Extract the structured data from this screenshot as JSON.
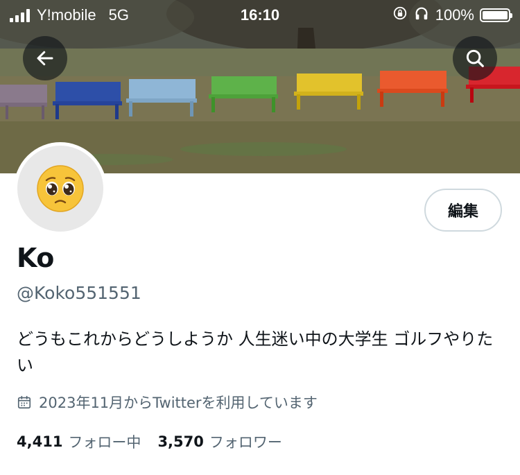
{
  "status_bar": {
    "carrier": "Y!mobile",
    "network": "5G",
    "time": "16:10",
    "battery": "100%"
  },
  "profile": {
    "display_name": "Ko",
    "handle": "@Koko551551",
    "bio": "どうもこれからどうしようか 人生迷い中の大学生 ゴルフやりたい",
    "joined": "2023年11月からTwitterを利用しています",
    "following_count": "4,411",
    "following_label": "フォロー中",
    "followers_count": "3,570",
    "followers_label": "フォロワー",
    "edit_button": "編集"
  },
  "icons": {
    "back": "arrow-left-icon",
    "search": "search-icon",
    "calendar": "calendar-icon",
    "avatar": "pleading-face-emoji"
  },
  "colors": {
    "text_primary": "#0f1419",
    "text_secondary": "#536471",
    "button_border": "#cfd9de",
    "nav_button_bg": "#0f1419"
  }
}
